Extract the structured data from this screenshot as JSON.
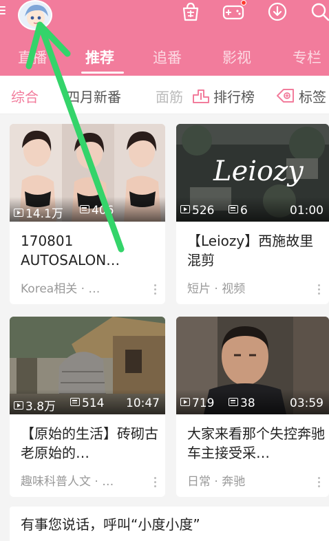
{
  "header": {
    "icons": [
      "menu-icon",
      "shop-icon",
      "game-icon",
      "download-icon",
      "search-icon"
    ],
    "accent_color": "#f27c9c"
  },
  "tabs": [
    "直播",
    "推荐",
    "追番",
    "影视",
    "专栏"
  ],
  "active_tab": "推荐",
  "subnav": {
    "items": [
      "综合",
      "四月新番",
      "面筋",
      "排行榜",
      "标签"
    ],
    "active": "综合"
  },
  "cards": [
    {
      "views": "14.1万",
      "danmaku": "406",
      "duration": "",
      "title": "170801 AUTOSALON…",
      "meta": "Korea相关 · …"
    },
    {
      "views": "526",
      "danmaku": "6",
      "duration": "01:00",
      "title": "【Leiozy】西施故里混剪",
      "meta": "短片 · 视频",
      "thumb_text": "Leiozy"
    },
    {
      "views": "3.8万",
      "danmaku": "514",
      "duration": "10:47",
      "title": "【原始的生活】砖砌古老原始的…",
      "meta": "趣味科普人文 · …"
    },
    {
      "views": "719",
      "danmaku": "38",
      "duration": "03:59",
      "title": "大家来看那个失控奔驰车主接受采…",
      "meta": "日常 · 奔驰"
    }
  ],
  "voice_prompt": "有事您说话，呼叫“小度小度”"
}
